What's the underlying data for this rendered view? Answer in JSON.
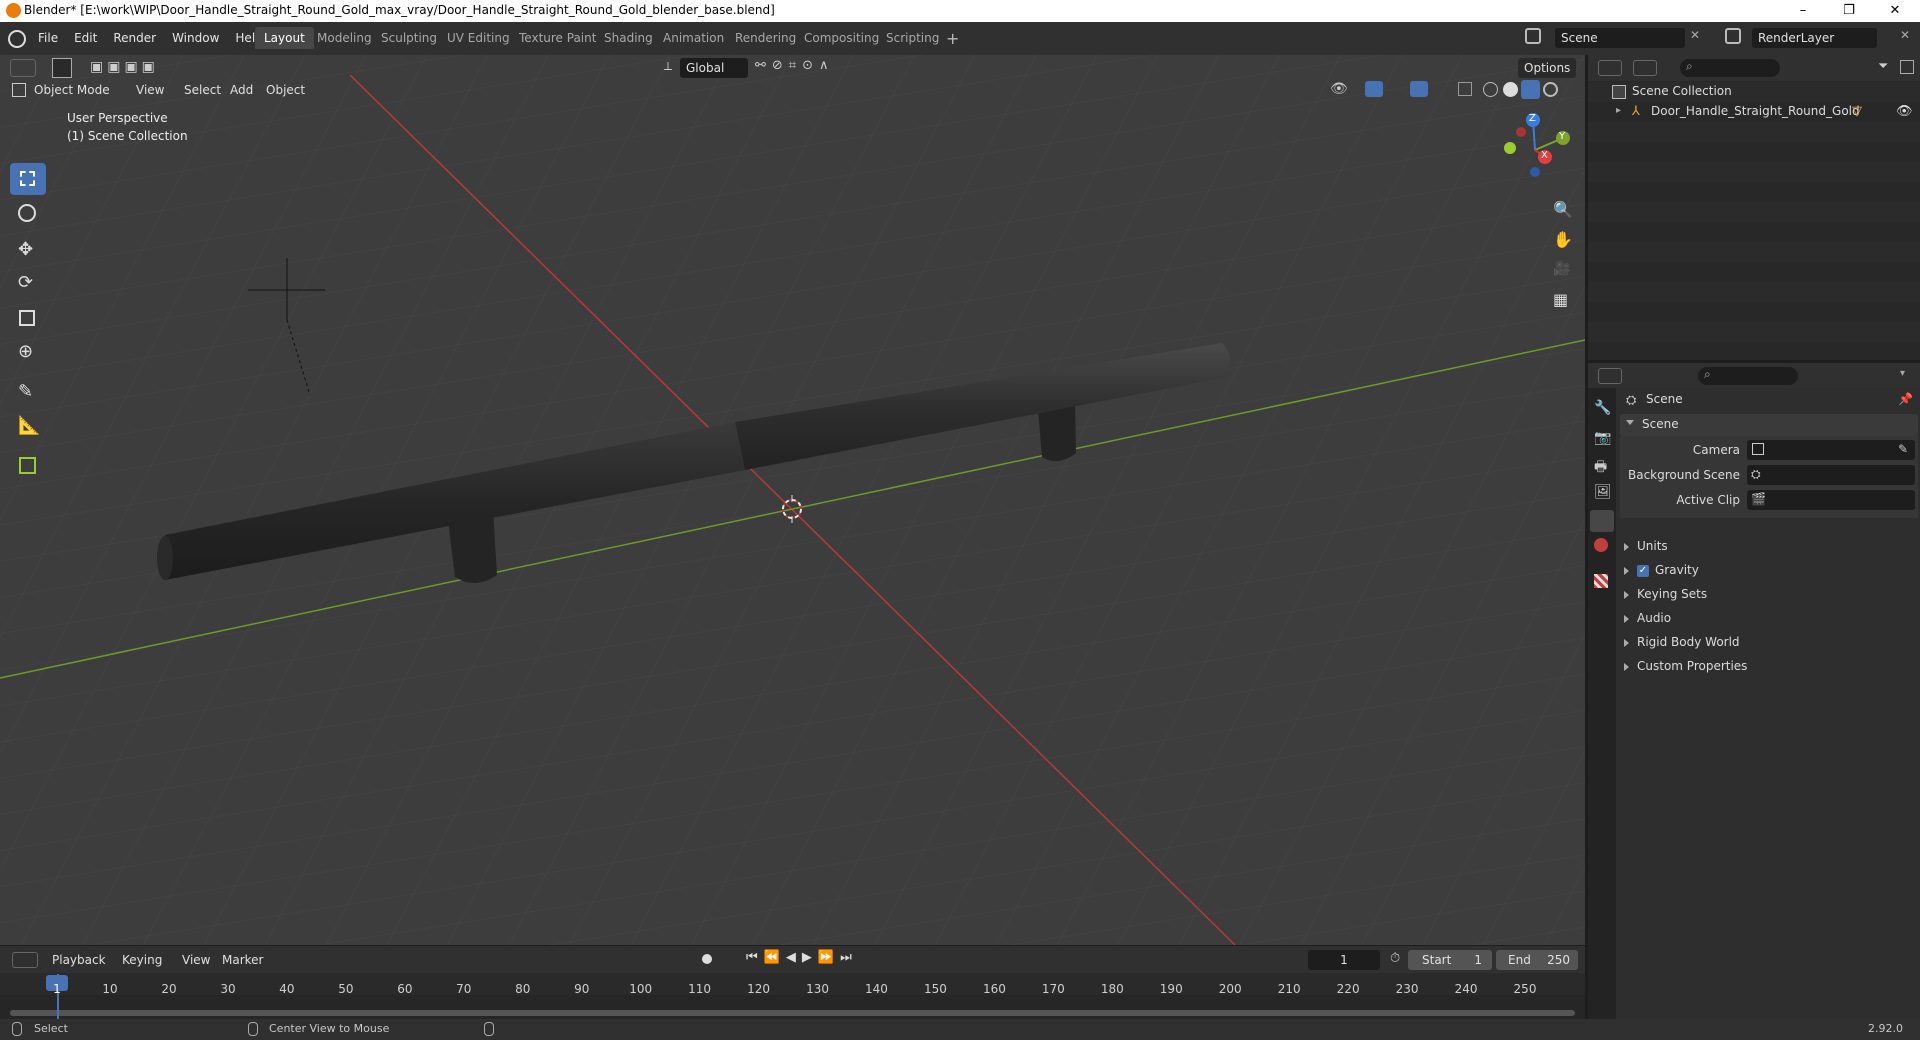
{
  "window": {
    "title": "Blender* [E:\\work\\WIP\\Door_Handle_Straight_Round_Gold_max_vray/Door_Handle_Straight_Round_Gold_blender_base.blend]",
    "minimize": "–",
    "maximize": "❐",
    "close": "✕"
  },
  "menu": [
    "File",
    "Edit",
    "Render",
    "Window",
    "Help"
  ],
  "workspaces": [
    "Layout",
    "Modeling",
    "Sculpting",
    "UV Editing",
    "Texture Paint",
    "Shading",
    "Animation",
    "Rendering",
    "Compositing",
    "Scripting"
  ],
  "scene_field": "Scene",
  "render_layer_field": "RenderLayer",
  "viewport": {
    "transform_orientation": "Global",
    "options_label": "Options",
    "mode": "Object Mode",
    "header_menus": [
      "View",
      "Select",
      "Add",
      "Object"
    ],
    "perspective_label": "User Perspective",
    "collection_label": "(1) Scene Collection",
    "gizmo_axes": {
      "x": "X",
      "y": "Y",
      "z": "Z"
    },
    "colors": {
      "background": "#3d3d3d",
      "x_axis": "#c0392b",
      "y_axis": "#7ea22f",
      "handle": "#262626"
    }
  },
  "outliner": {
    "root": "Scene Collection",
    "object": "Door_Handle_Straight_Round_Gold"
  },
  "properties": {
    "context": "Scene",
    "panel": "Scene",
    "fields": [
      {
        "label": "Camera",
        "value": ""
      },
      {
        "label": "Background Scene",
        "value": ""
      },
      {
        "label": "Active Clip",
        "value": ""
      }
    ],
    "sections": [
      {
        "label": "Units",
        "checkbox": false
      },
      {
        "label": "Gravity",
        "checkbox": true
      },
      {
        "label": "Keying Sets",
        "checkbox": false
      },
      {
        "label": "Audio",
        "checkbox": false
      },
      {
        "label": "Rigid Body World",
        "checkbox": false
      },
      {
        "label": "Custom Properties",
        "checkbox": false
      }
    ]
  },
  "timeline": {
    "menus": [
      "Playback",
      "Keying",
      "View",
      "Marker"
    ],
    "current_frame": "1",
    "start_label": "Start",
    "start_value": "1",
    "end_label": "End",
    "end_value": "250",
    "ticks": [
      "1",
      "10",
      "20",
      "30",
      "40",
      "50",
      "60",
      "70",
      "80",
      "90",
      "100",
      "110",
      "120",
      "130",
      "140",
      "150",
      "160",
      "170",
      "180",
      "190",
      "200",
      "210",
      "220",
      "230",
      "240",
      "250"
    ]
  },
  "status": {
    "select": "Select",
    "center_view": "Center View to Mouse",
    "version": "2.92.0"
  }
}
